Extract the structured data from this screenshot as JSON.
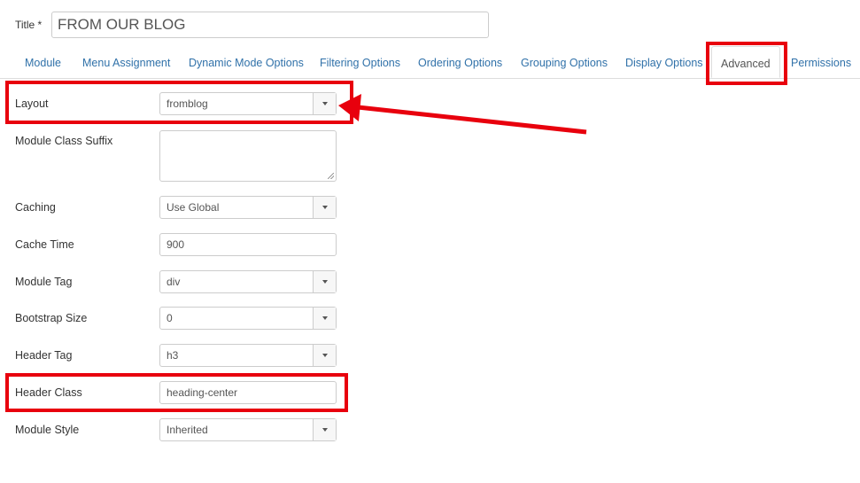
{
  "title": {
    "label": "Title *",
    "value": "FROM OUR BLOG"
  },
  "tabs": [
    {
      "label": "Module"
    },
    {
      "label": "Menu Assignment"
    },
    {
      "label": "Dynamic Mode Options"
    },
    {
      "label": "Filtering Options"
    },
    {
      "label": "Ordering Options"
    },
    {
      "label": "Grouping Options"
    },
    {
      "label": "Display Options"
    },
    {
      "label": "Advanced"
    },
    {
      "label": "Permissions"
    }
  ],
  "active_tab": "Advanced",
  "fields": {
    "layout": {
      "label": "Layout",
      "value": "fromblog"
    },
    "module_class_suffix": {
      "label": "Module Class Suffix",
      "value": ""
    },
    "caching": {
      "label": "Caching",
      "value": "Use Global"
    },
    "cache_time": {
      "label": "Cache Time",
      "value": "900"
    },
    "module_tag": {
      "label": "Module Tag",
      "value": "div"
    },
    "bootstrap_size": {
      "label": "Bootstrap Size",
      "value": "0"
    },
    "header_tag": {
      "label": "Header Tag",
      "value": "h3"
    },
    "header_class": {
      "label": "Header Class",
      "value": "heading-center"
    },
    "module_style": {
      "label": "Module Style",
      "value": "Inherited"
    }
  },
  "colors": {
    "annotation": "#e8000d",
    "tab_link": "#3071a9"
  },
  "icons": {
    "select": "caret-down-icon",
    "annotation": "arrow-icon"
  }
}
